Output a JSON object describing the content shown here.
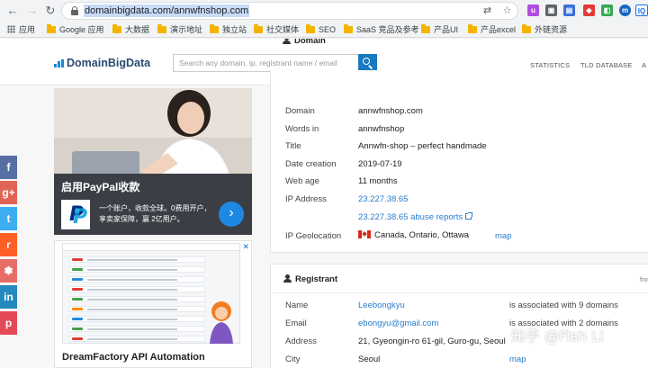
{
  "browser": {
    "url": "domainbigdata.com/annwfnshop.com",
    "extensions": [
      {
        "name": "IQ",
        "color": "#ffffff",
        "text_color": "#1a73e8",
        "label": "IQ"
      }
    ],
    "bookmarks": [
      {
        "label": "应用",
        "icon": "apps-grid-icon"
      },
      {
        "label": "Google 应用",
        "icon": "folder-icon"
      },
      {
        "label": "大数据",
        "icon": "folder-icon"
      },
      {
        "label": "演示地址",
        "icon": "folder-icon"
      },
      {
        "label": "独立站",
        "icon": "folder-icon"
      },
      {
        "label": "社交媒体",
        "icon": "folder-icon"
      },
      {
        "label": "SEO",
        "icon": "folder-icon"
      },
      {
        "label": "SaaS 竞品及参考",
        "icon": "folder-icon"
      },
      {
        "label": "产品UI",
        "icon": "folder-icon"
      },
      {
        "label": "产品excel",
        "icon": "folder-icon"
      },
      {
        "label": "外链资源",
        "icon": "folder-icon"
      }
    ]
  },
  "site": {
    "logo_text": "DomainBigData",
    "search_placeholder": "Search any domain, ip, registrant name / email",
    "nav": [
      "STATISTICS",
      "TLD DATABASE",
      "A"
    ]
  },
  "ads": {
    "paypal": {
      "title": "启用PayPal收款",
      "text_line1": "一个账户，收款全球。0费用开户，",
      "text_line2": "享卖家保障，赢 2亿用户。",
      "go_glyph": "›"
    },
    "dreamfactory": {
      "title": "DreamFactory API Automation",
      "close_glyph": "✕",
      "info_glyph": "i"
    }
  },
  "share_bar": [
    {
      "name": "facebook",
      "glyph": "f",
      "color": "#3b5998"
    },
    {
      "name": "google-plus",
      "glyph": "g+",
      "color": "#dd4b39"
    },
    {
      "name": "twitter",
      "glyph": "t",
      "color": "#1da1f2"
    },
    {
      "name": "reddit",
      "glyph": "r",
      "color": "#ff4500"
    },
    {
      "name": "paw",
      "glyph": "✽",
      "color": "#e2554e"
    },
    {
      "name": "linkedin",
      "glyph": "in",
      "color": "#0077b5"
    },
    {
      "name": "pinterest",
      "glyph": "p",
      "color": "#e02c3a"
    }
  ],
  "domain_card": {
    "heading": "Domain",
    "rows": [
      {
        "label": "Domain",
        "value": "annwfnshop.com"
      },
      {
        "label": "Words in",
        "value": "annwfnshop"
      },
      {
        "label": "Title",
        "value": "Annwfn-shop – perfect handmade"
      },
      {
        "label": "Date creation",
        "value": "2019-07-19"
      },
      {
        "label": "Web age",
        "value": "11 months"
      },
      {
        "label": "IP Address",
        "value": "23.227.38.65"
      }
    ],
    "abuse_link": "23.227.38.65 abuse reports",
    "geo_label": "IP Geolocation",
    "geo_value": "Canada, Ontario, Ottawa",
    "geo_map": "map"
  },
  "registrant_card": {
    "heading": "Registrant",
    "heading_right": "fro",
    "rows": [
      {
        "label": "Name",
        "value": "Leebongkyu",
        "note": "is associated with 9 domains"
      },
      {
        "label": "Email",
        "value": "ebongyu@gmail.com",
        "note": "is associated with 2 domains"
      },
      {
        "label": "Address",
        "value": "21, Gyeongin-ro 61-gil, Guro-gu, Seoul",
        "note": ""
      },
      {
        "label": "City",
        "value": "Seoul",
        "note": "map"
      }
    ]
  },
  "watermark": "知乎 @Fish Li"
}
